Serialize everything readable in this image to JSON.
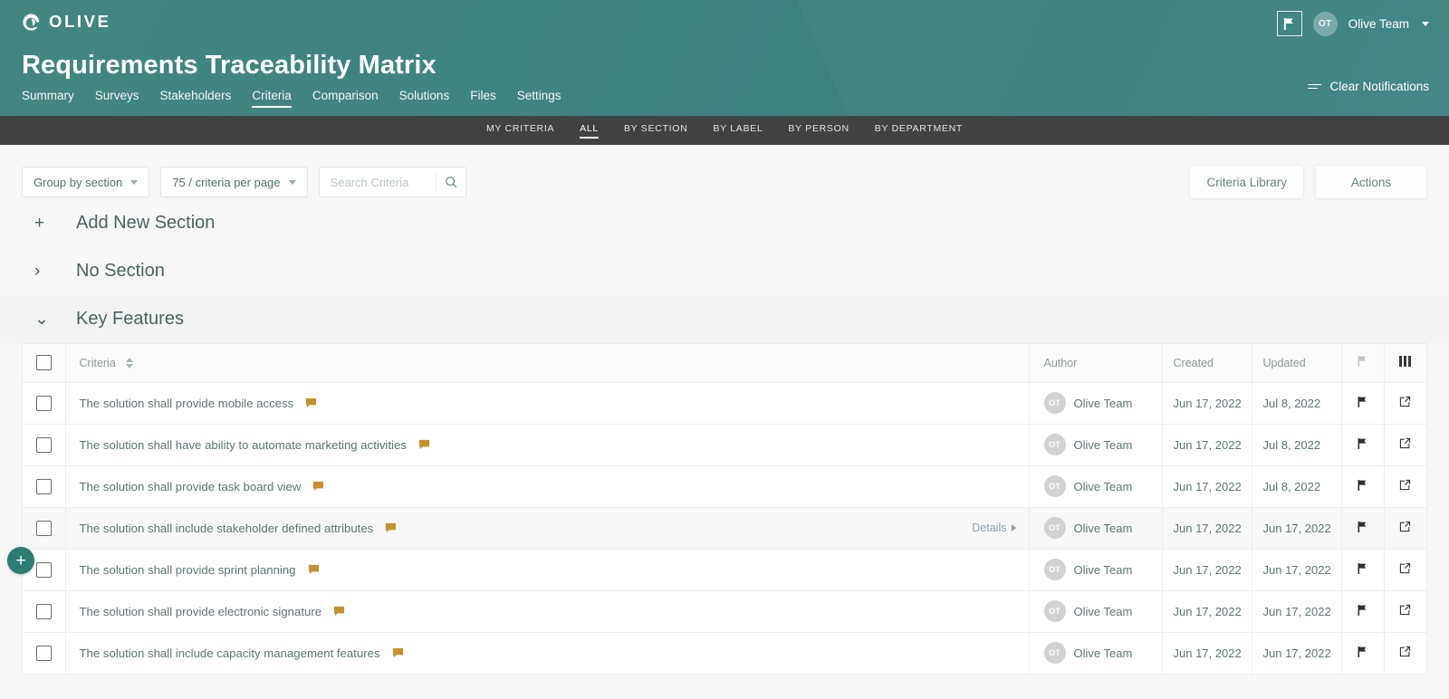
{
  "brand": {
    "name": "OLIVE",
    "logo_icon": "olive-logo-icon",
    "header_color": "#3d8380"
  },
  "header": {
    "title": "Requirements Traceability Matrix",
    "nav": [
      {
        "label": "Summary",
        "active": false
      },
      {
        "label": "Surveys",
        "active": false
      },
      {
        "label": "Stakeholders",
        "active": false
      },
      {
        "label": "Criteria",
        "active": true
      },
      {
        "label": "Comparison",
        "active": false
      },
      {
        "label": "Solutions",
        "active": false
      },
      {
        "label": "Files",
        "active": false
      },
      {
        "label": "Settings",
        "active": false
      }
    ],
    "flag_icon": "flag-icon",
    "avatar_initials": "OT",
    "user_name": "Olive Team",
    "clear_notifications": "Clear Notifications"
  },
  "subnav": {
    "items": [
      {
        "label": "MY CRITERIA",
        "active": false
      },
      {
        "label": "ALL",
        "active": true
      },
      {
        "label": "BY SECTION",
        "active": false
      },
      {
        "label": "BY LABEL",
        "active": false
      },
      {
        "label": "BY PERSON",
        "active": false
      },
      {
        "label": "BY DEPARTMENT",
        "active": false
      }
    ]
  },
  "toolbar": {
    "group_by": "Group by section",
    "per_page": "75 / criteria per page",
    "search_placeholder": "Search Criteria",
    "search_value": "",
    "search_icon": "search-icon",
    "criteria_library": "Criteria Library",
    "actions": "Actions"
  },
  "sections": [
    {
      "label": "Add New Section",
      "icon": "plus-icon",
      "state": "add"
    },
    {
      "label": "No Section",
      "icon": "chevron-right-icon",
      "state": "collapsed"
    },
    {
      "label": "Key Features",
      "icon": "chevron-down-icon",
      "state": "expanded"
    }
  ],
  "fab": {
    "label": "+",
    "icon": "plus-circle-icon"
  },
  "table": {
    "columns": {
      "criteria": "Criteria",
      "author": "Author",
      "created": "Created",
      "updated": "Updated",
      "flag_icon": "flag-icon",
      "columns_icon": "columns-icon"
    },
    "details_label": "Details",
    "rows": [
      {
        "criteria": "The solution shall provide mobile access",
        "author": "Olive Team",
        "initials": "OT",
        "created": "Jun 17, 2022",
        "updated": "Jul 8, 2022",
        "hovered": false,
        "flagged": true
      },
      {
        "criteria": "The solution shall have ability to automate marketing activities",
        "author": "Olive Team",
        "initials": "OT",
        "created": "Jun 17, 2022",
        "updated": "Jul 8, 2022",
        "hovered": false,
        "flagged": true
      },
      {
        "criteria": "The solution shall provide task board view",
        "author": "Olive Team",
        "initials": "OT",
        "created": "Jun 17, 2022",
        "updated": "Jul 8, 2022",
        "hovered": false,
        "flagged": true
      },
      {
        "criteria": "The solution shall include stakeholder defined attributes",
        "author": "Olive Team",
        "initials": "OT",
        "created": "Jun 17, 2022",
        "updated": "Jun 17, 2022",
        "hovered": true,
        "flagged": true
      },
      {
        "criteria": "The solution shall provide sprint planning",
        "author": "Olive Team",
        "initials": "OT",
        "created": "Jun 17, 2022",
        "updated": "Jun 17, 2022",
        "hovered": false,
        "flagged": true
      },
      {
        "criteria": "The solution shall provide electronic signature",
        "author": "Olive Team",
        "initials": "OT",
        "created": "Jun 17, 2022",
        "updated": "Jun 17, 2022",
        "hovered": false,
        "flagged": true
      },
      {
        "criteria": "The solution shall include capacity management features",
        "author": "Olive Team",
        "initials": "OT",
        "created": "Jun 17, 2022",
        "updated": "Jun 17, 2022",
        "hovered": false,
        "flagged": true
      }
    ]
  },
  "colors": {
    "accent_teal": "#3d8380",
    "fab_green": "#2a7d72",
    "flag_gold": "#c6902f",
    "subnav_dark": "#424242"
  }
}
